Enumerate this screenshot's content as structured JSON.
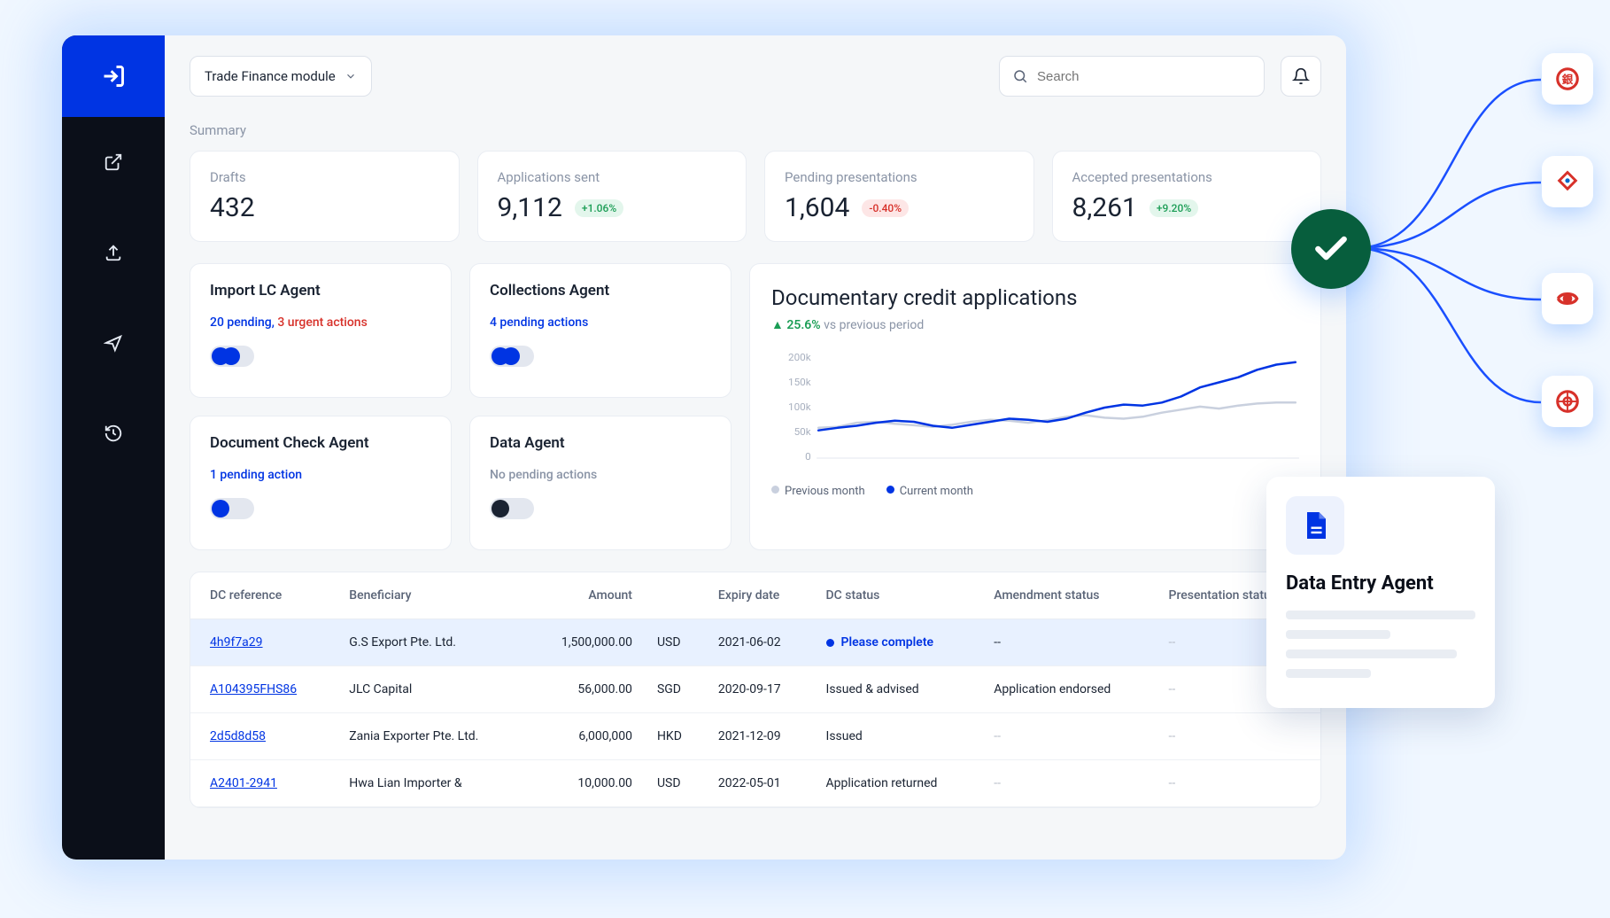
{
  "module": {
    "label": "Trade Finance module"
  },
  "search": {
    "placeholder": "Search"
  },
  "section_summary": "Summary",
  "stats": [
    {
      "label": "Drafts",
      "value": "432",
      "delta": "",
      "delta_class": ""
    },
    {
      "label": "Applications sent",
      "value": "9,112",
      "delta": "+1.06%",
      "delta_class": "green"
    },
    {
      "label": "Pending presentations",
      "value": "1,604",
      "delta": "-0.40%",
      "delta_class": "red"
    },
    {
      "label": "Accepted presentations",
      "value": "8,261",
      "delta": "+9.20%",
      "delta_class": "green"
    }
  ],
  "agents": [
    {
      "title": "Import LC Agent",
      "pending_text": "20 pending, ",
      "urgent_text": "3 urgent actions",
      "toggle_on": true,
      "double": true
    },
    {
      "title": "Collections Agent",
      "pending_text": "4 pending actions",
      "urgent_text": "",
      "toggle_on": true,
      "double": true
    },
    {
      "title": "Document Check Agent",
      "pending_text": "1 pending action",
      "urgent_text": "",
      "toggle_on": true,
      "double": false
    },
    {
      "title": "Data Agent",
      "pending_text": "No pending actions",
      "urgent_text": "",
      "toggle_on": false,
      "double": false,
      "grey": true
    }
  ],
  "chart": {
    "title": "Documentary credit applications",
    "delta": "▲ 25.6%",
    "delta_suffix": " vs previous period",
    "legend_prev": "Previous month",
    "legend_cur": "Current month",
    "y_ticks": [
      "0",
      "50k",
      "100k",
      "150k",
      "200k"
    ]
  },
  "chart_data": {
    "type": "line",
    "x": [
      1,
      2,
      3,
      4,
      5,
      6,
      7,
      8,
      9,
      10,
      11,
      12,
      13,
      14,
      15,
      16,
      17,
      18,
      19,
      20,
      21,
      22,
      23,
      24,
      25,
      26
    ],
    "series": [
      {
        "name": "Previous month",
        "color": "#c9d0de",
        "values": [
          60,
          62,
          70,
          72,
          68,
          65,
          62,
          66,
          72,
          76,
          74,
          70,
          75,
          82,
          85,
          80,
          78,
          82,
          90,
          96,
          102,
          98,
          104,
          108,
          110,
          110
        ]
      },
      {
        "name": "Current month",
        "color": "#0034e3",
        "values": [
          55,
          60,
          64,
          70,
          74,
          72,
          64,
          60,
          66,
          72,
          78,
          76,
          72,
          78,
          90,
          100,
          106,
          104,
          110,
          122,
          140,
          150,
          160,
          175,
          185,
          190
        ]
      }
    ],
    "ylim": [
      0,
      200
    ],
    "ylabel": "",
    "xlabel": "",
    "title": "Documentary credit applications"
  },
  "table": {
    "headers": [
      "DC reference",
      "Beneficiary",
      "Amount",
      "",
      "Expiry date",
      "DC status",
      "Amendment status",
      "Presentation status"
    ],
    "rows": [
      {
        "ref": "4h9f7a29",
        "ben": "G.S Export Pte. Ltd.",
        "amt": "1,500,000.00",
        "cur": "USD",
        "exp": "2021-06-02",
        "dc": "Please complete",
        "dc_dot": true,
        "dc_bold": true,
        "amend": "--",
        "pres": "--",
        "highlight": true
      },
      {
        "ref": "A104395FHS86",
        "ben": "JLC Capital",
        "amt": "56,000.00",
        "cur": "SGD",
        "exp": "2020-09-17",
        "dc": "Issued & advised",
        "amend": "Application endorsed",
        "pres": "--"
      },
      {
        "ref": "2d5d8d58",
        "ben": "Zania Exporter Pte. Ltd.",
        "amt": "6,000,000",
        "cur": "HKD",
        "exp": "2021-12-09",
        "dc": "Issued",
        "amend": "--",
        "pres": "--",
        "amend_muted": true
      },
      {
        "ref": "A2401-2941",
        "ben": "Hwa Lian Importer &",
        "amt": "10,000.00",
        "cur": "USD",
        "exp": "2022-05-01",
        "dc": "Application returned",
        "amend": "--",
        "pres": "--",
        "amend_muted": true
      }
    ]
  },
  "entry_card": {
    "title": "Data Entry Agent"
  },
  "colors": {
    "accent": "#0034e3",
    "green": "#1b9d55",
    "red": "#d7312a"
  }
}
